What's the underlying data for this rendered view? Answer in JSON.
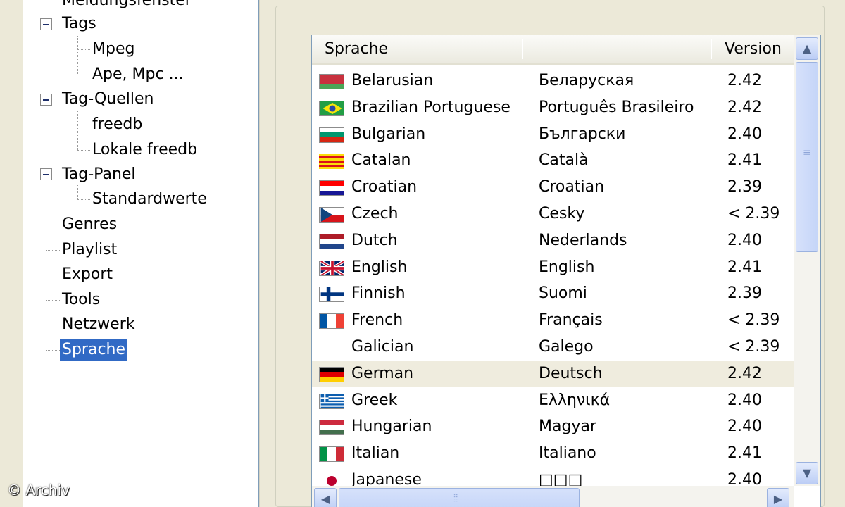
{
  "tree": {
    "items": [
      {
        "label": "Meldungsfenster",
        "level": 1
      },
      {
        "label": "Tags",
        "level": 1
      },
      {
        "label": "Mpeg",
        "level": 2
      },
      {
        "label": "Ape, Mpc ...",
        "level": 2
      },
      {
        "label": "Tag-Quellen",
        "level": 1
      },
      {
        "label": "freedb",
        "level": 2
      },
      {
        "label": "Lokale freedb",
        "level": 2
      },
      {
        "label": "Tag-Panel",
        "level": 1
      },
      {
        "label": "Standardwerte",
        "level": 2
      },
      {
        "label": "Genres",
        "level": 1
      },
      {
        "label": "Playlist",
        "level": 1
      },
      {
        "label": "Export",
        "level": 1
      },
      {
        "label": "Tools",
        "level": 1
      },
      {
        "label": "Netzwerk",
        "level": 1
      },
      {
        "label": "Sprache",
        "level": 1,
        "selected": true
      }
    ]
  },
  "languages": {
    "columns": {
      "language": "Sprache",
      "native": "",
      "version": "Version"
    },
    "rows": [
      {
        "name": "Belarusian",
        "native": "Беларуская",
        "version": "2.42",
        "flag": "belarus-flag-icon"
      },
      {
        "name": "Brazilian Portuguese",
        "native": "Português Brasileiro",
        "version": "2.42",
        "flag": "brazil-flag-icon"
      },
      {
        "name": "Bulgarian",
        "native": "Български",
        "version": "2.40",
        "flag": "bulgaria-flag-icon"
      },
      {
        "name": "Catalan",
        "native": "Català",
        "version": "2.41",
        "flag": "catalonia-flag-icon"
      },
      {
        "name": "Croatian",
        "native": "Croatian",
        "version": "2.39",
        "flag": "croatia-flag-icon"
      },
      {
        "name": "Czech",
        "native": "Cesky",
        "version": "< 2.39",
        "flag": "czech-flag-icon"
      },
      {
        "name": "Dutch",
        "native": "Nederlands",
        "version": "2.40",
        "flag": "netherlands-flag-icon"
      },
      {
        "name": "English",
        "native": "English",
        "version": "2.41",
        "flag": "uk-flag-icon"
      },
      {
        "name": "Finnish",
        "native": "Suomi",
        "version": "2.39",
        "flag": "finland-flag-icon"
      },
      {
        "name": "French",
        "native": "Français",
        "version": "< 2.39",
        "flag": "france-flag-icon"
      },
      {
        "name": "Galician",
        "native": "Galego",
        "version": "< 2.39",
        "flag": ""
      },
      {
        "name": "German",
        "native": "Deutsch",
        "version": "2.42",
        "flag": "germany-flag-icon",
        "selected": true
      },
      {
        "name": "Greek",
        "native": "Ελληνικά",
        "version": "2.40",
        "flag": "greece-flag-icon"
      },
      {
        "name": "Hungarian",
        "native": "Magyar",
        "version": "2.40",
        "flag": "hungary-flag-icon"
      },
      {
        "name": "Italian",
        "native": "Italiano",
        "version": "2.41",
        "flag": "italy-flag-icon"
      },
      {
        "name": "Japanese",
        "native": "□□□",
        "version": "2.40",
        "flag": "japan-flag-icon"
      }
    ]
  },
  "scrollbar": {
    "up_icon": "chevron-up-icon",
    "down_icon": "chevron-down-icon",
    "left_icon": "chevron-left-icon",
    "right_icon": "chevron-right-icon"
  },
  "watermark": "© Archiv",
  "colors": {
    "selection": "#316ac5",
    "row_highlight": "#efecde",
    "window": "#ece9d8"
  }
}
